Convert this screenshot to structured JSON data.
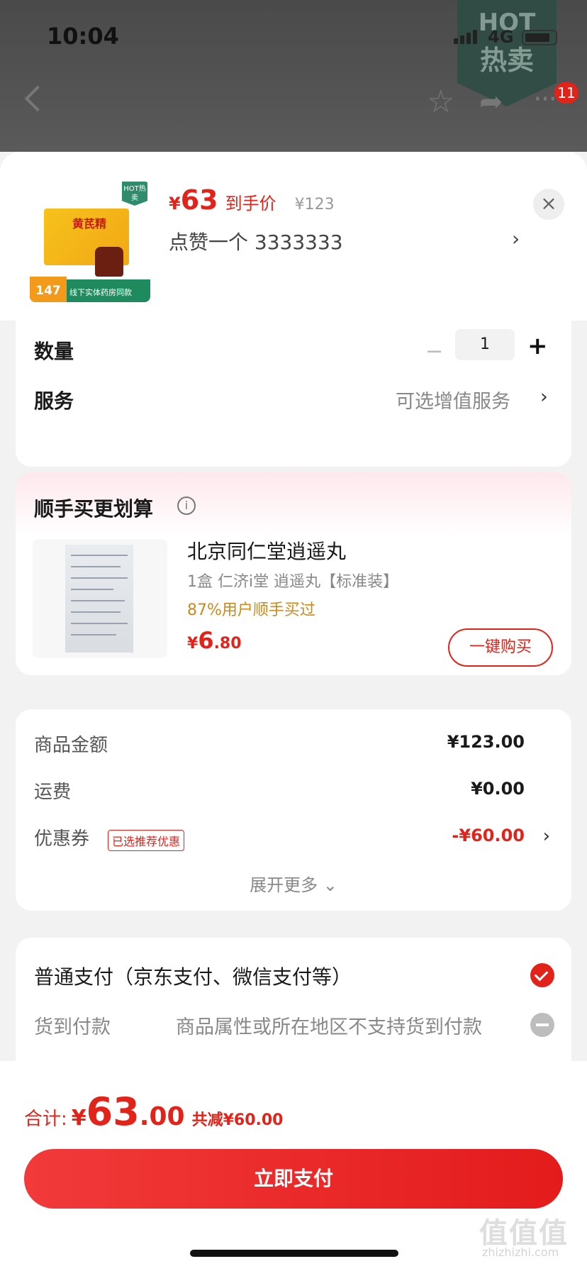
{
  "status_bar": {
    "time": "10:04",
    "network": "4G"
  },
  "hot_flag": {
    "line1": "HOT",
    "line2": "热卖"
  },
  "nav": {
    "badge_count": "11"
  },
  "product": {
    "price_symbol": "¥",
    "price": "63",
    "price_tag": "到手价",
    "original_price": "¥123",
    "variant": "点赞一个  3333333",
    "thumb_box_text": "黄芪精",
    "thumb_hot": "HOT热卖",
    "thumb_strip_price": "147",
    "thumb_strip_text": "线下实体药房同款"
  },
  "quantity": {
    "label": "数量",
    "value": "1",
    "minus": "−",
    "plus": "+"
  },
  "service": {
    "label": "服务",
    "value": "可选增值服务"
  },
  "addon": {
    "title": "顺手买更划算",
    "name": "北京同仁堂逍遥丸",
    "spec": "1盒 仁济i堂 逍遥丸【标准装】",
    "percent_text": "87%用户顺手买过",
    "price_symbol": "¥",
    "price_int": "6",
    "price_dec": ".80",
    "buy_label": "一键购买"
  },
  "summary": {
    "rows": [
      {
        "label": "商品金额",
        "value": "¥123.00"
      },
      {
        "label": "运费",
        "value": "¥0.00"
      },
      {
        "label": "优惠券",
        "value": "-¥60.00",
        "badge": "已选推荐优惠"
      }
    ],
    "expand": "展开更多 ⌄"
  },
  "payment": {
    "option1": "普通支付（京东支付、微信支付等）",
    "option2_label": "货到付款",
    "option2_note": "商品属性或所在地区不支持货到付款"
  },
  "footer": {
    "total_label": "合计:",
    "total_symbol": "¥",
    "total_int": "63",
    "total_dec": ".00",
    "saving": "共减¥60.00",
    "pay_button": "立即支付",
    "watermark": "值值值",
    "watermark_sub": "zhizhizhi.com"
  },
  "colors": {
    "accent": "#e2231a",
    "background": "#f2f2f2"
  }
}
